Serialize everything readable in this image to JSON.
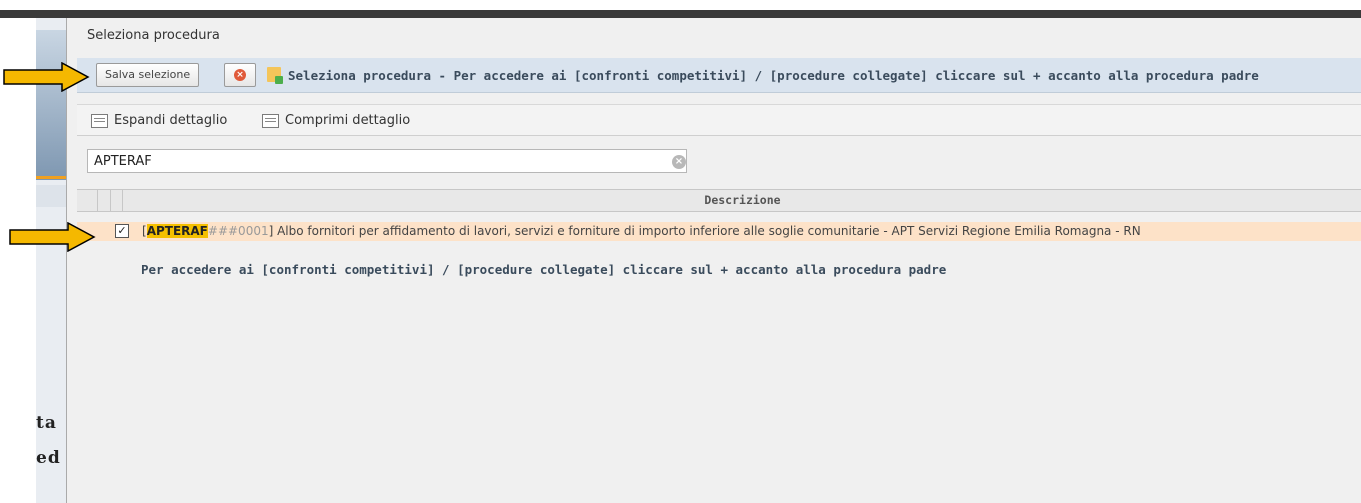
{
  "dialog": {
    "title": "Seleziona procedura"
  },
  "toolbar": {
    "save_label": "Salva selezione",
    "message": "Seleziona procedura - Per accedere ai [confronti competitivi] / [procedure collegate] cliccare sul + accanto alla procedura padre"
  },
  "details": {
    "expand_label": "Espandi dettaglio",
    "collapse_label": "Comprimi dettaglio"
  },
  "search": {
    "value": "APTERAF"
  },
  "grid": {
    "column_header": "Descrizione",
    "rows": [
      {
        "checked": true,
        "prefix": "[",
        "code_highlight": "APTERAF",
        "code_rest": "###0001",
        "text": "] Albo fornitori per affidamento di lavori, servizi e forniture di importo inferiore alle soglie comunitarie - APT Servizi Regione Emilia Romagna - RN"
      }
    ]
  },
  "footer": {
    "message": "Per accedere ai [confronti competitivi] / [procedure collegate] cliccare sul + accanto alla procedura padre"
  },
  "background": {
    "text_line1": "ta",
    "text_line2": "ed"
  },
  "colors": {
    "accent_arrow": "#f5b800",
    "row_highlight": "#fde2c8",
    "code_highlight": "#f5c000"
  }
}
